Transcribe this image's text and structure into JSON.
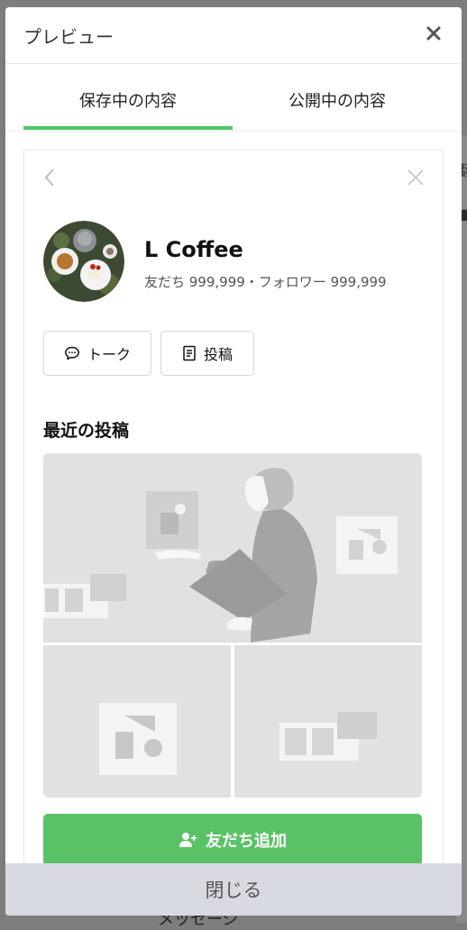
{
  "modal": {
    "title": "プレビュー",
    "close_icon": "close-icon"
  },
  "tabs": [
    {
      "label": "保存中の内容",
      "active": true
    },
    {
      "label": "公開中の内容",
      "active": false
    }
  ],
  "preview": {
    "account": {
      "name": "L Coffee",
      "stats": "友だち 999,999・フォロワー 999,999"
    },
    "buttons": {
      "talk_label": "トーク",
      "posts_label": "投稿"
    },
    "recent_posts_title": "最近の投稿",
    "add_friend_label": "友だち追加"
  },
  "footer": {
    "close_label": "閉じる"
  },
  "background": {
    "partial_text": "メッセージ"
  },
  "colors": {
    "accent_green": "#4cc764",
    "button_green": "#5ac266",
    "footer_bg": "#d7dae0",
    "placeholder_gray": "#e1e1e1"
  }
}
